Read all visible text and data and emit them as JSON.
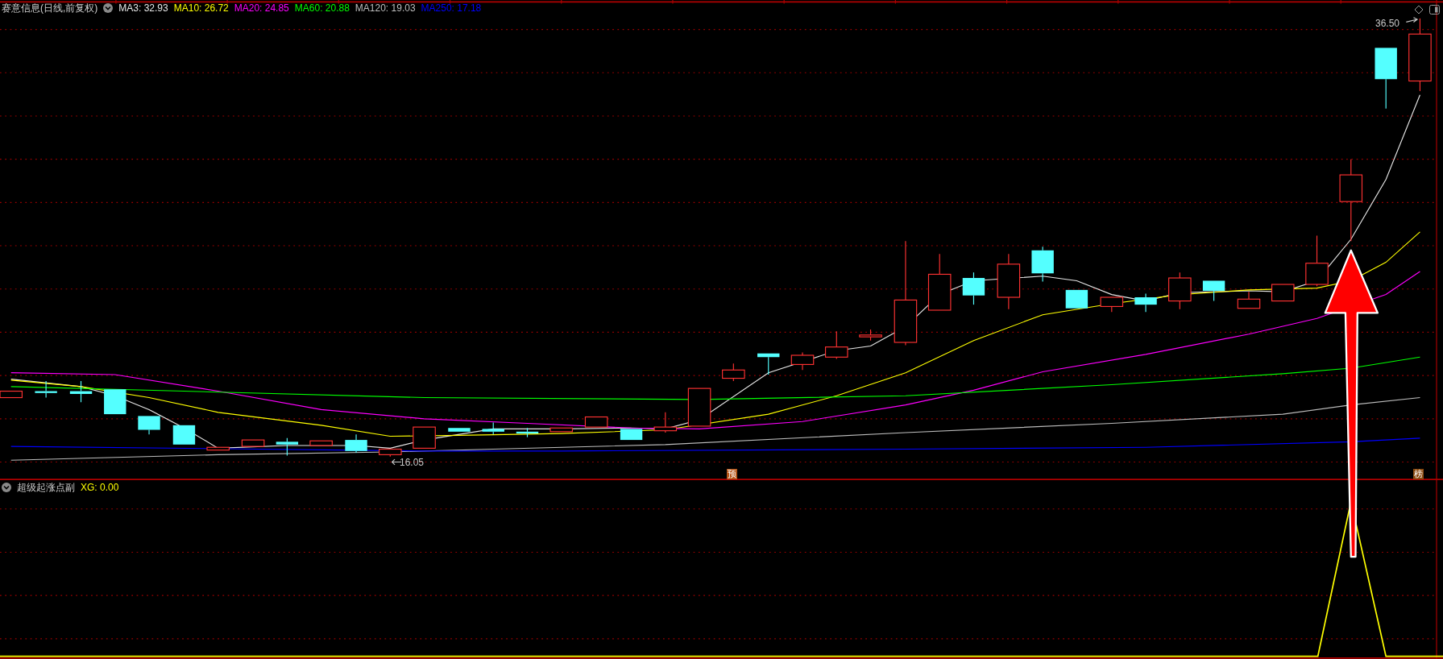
{
  "header": {
    "title": "赛意信息(日线,前复权)",
    "indicators": [
      {
        "label": "MA3: 32.93",
        "color": "#e6e6e6"
      },
      {
        "label": "MA10: 26.72",
        "color": "#ffff00"
      },
      {
        "label": "MA20: 24.85",
        "color": "#ff00ff"
      },
      {
        "label": "MA60: 20.88",
        "color": "#00ff00"
      },
      {
        "label": "MA120: 19.03",
        "color": "#bdbdbd"
      },
      {
        "label": "MA250: 17.18",
        "color": "#0000ff"
      }
    ]
  },
  "high_label": "36.50",
  "low_label": "16.05",
  "markers": [
    {
      "text": "预"
    },
    {
      "text": "榜"
    }
  ],
  "sub_panel": {
    "title": "超级起涨点副",
    "indicators": [
      {
        "label": "XG: 0.00",
        "color": "#ffff00"
      }
    ]
  }
}
